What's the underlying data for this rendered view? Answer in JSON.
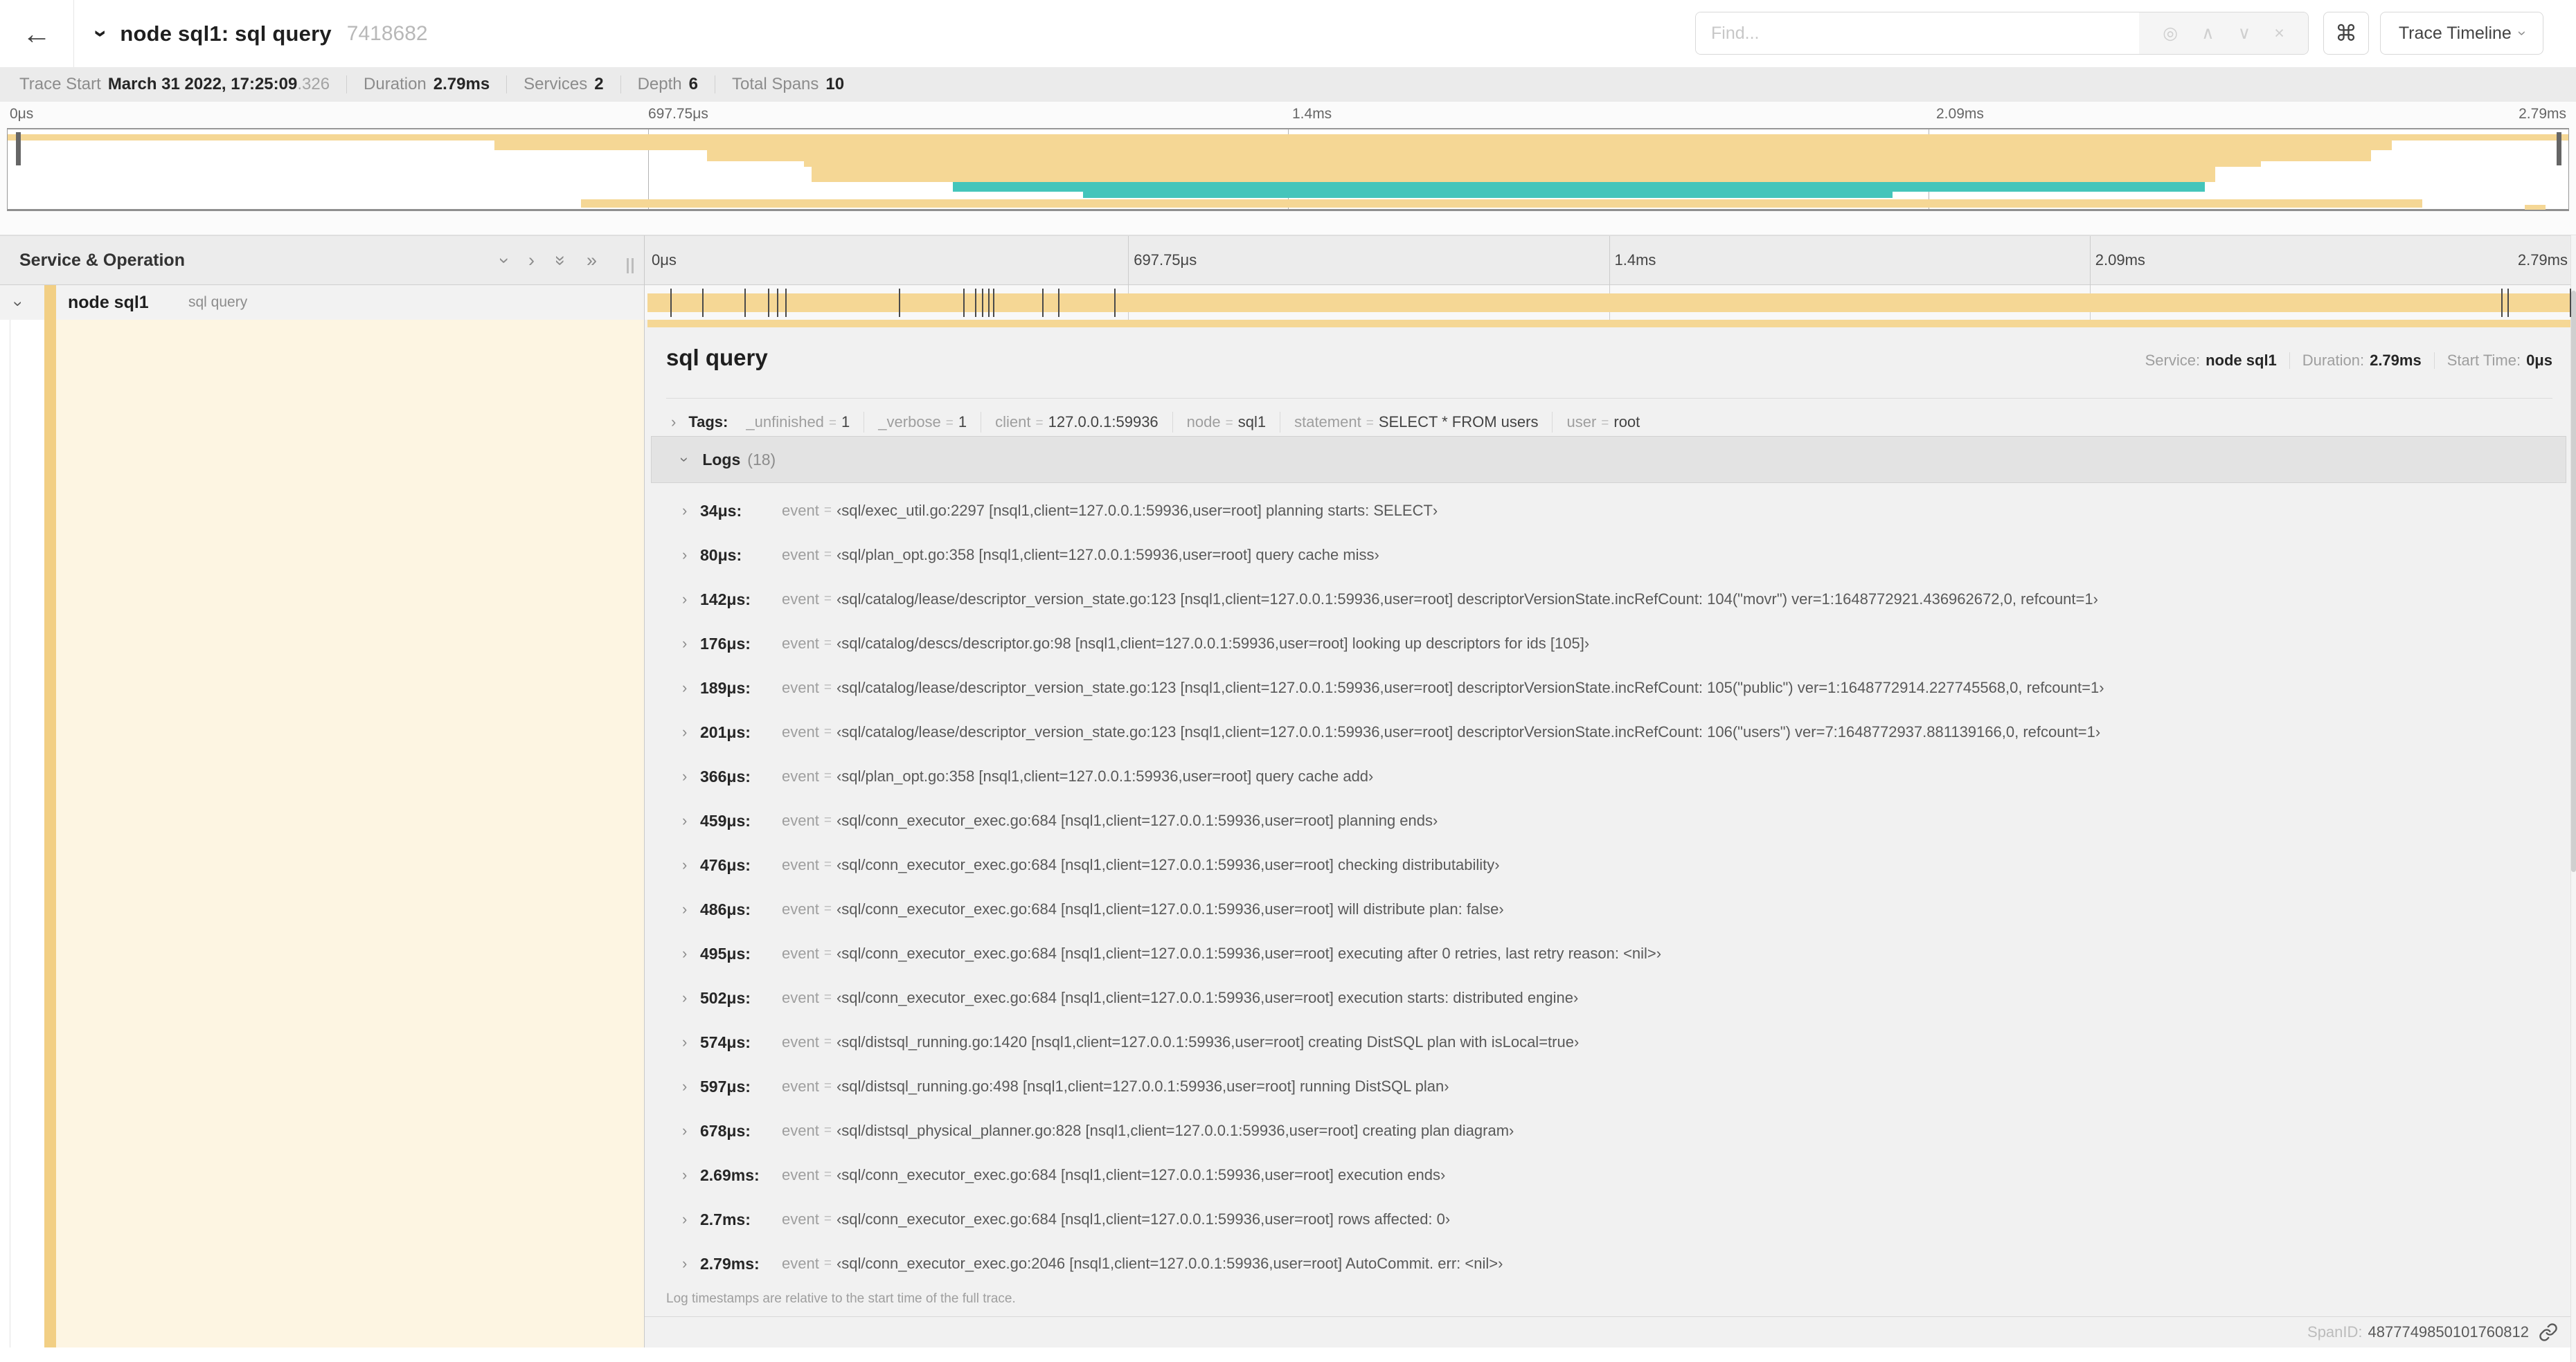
{
  "colors": {
    "span": "#f5d795",
    "span_stripe": "#f2cf84",
    "teal": "#44c5bb",
    "cream": "#fdf5e2"
  },
  "icons": {
    "back": "←",
    "chevron": "›",
    "double_chevron": "»",
    "locate": "◎",
    "prev": "∧",
    "next": "∨",
    "clear": "×",
    "command": "⌘"
  },
  "header": {
    "title": "node sql1: sql query",
    "trace_id": "7418682",
    "find_placeholder": "Find...",
    "view_dropdown": "Trace Timeline"
  },
  "trace_info": {
    "items": [
      {
        "label": "Trace Start",
        "value": "March 31 2022, 17:25:09",
        "suffix": ".326"
      },
      {
        "label": "Duration",
        "value": "2.79ms",
        "suffix": ""
      },
      {
        "label": "Services",
        "value": "2",
        "suffix": ""
      },
      {
        "label": "Depth",
        "value": "6",
        "suffix": ""
      },
      {
        "label": "Total Spans",
        "value": "10",
        "suffix": ""
      }
    ]
  },
  "ticks": [
    "0μs",
    "697.75μs",
    "1.4ms",
    "2.09ms",
    "2.79ms"
  ],
  "minimap": {
    "bars": [
      {
        "l": 0,
        "w": 100,
        "t": 7,
        "h": 9,
        "c": "span"
      },
      {
        "l": 19.0,
        "w": 74.1,
        "t": 16,
        "h": 14,
        "c": "span"
      },
      {
        "l": 27.3,
        "w": 65.0,
        "t": 30,
        "h": 16,
        "c": "span"
      },
      {
        "l": 31.1,
        "w": 56.9,
        "t": 46,
        "h": 8,
        "c": "span"
      },
      {
        "l": 31.4,
        "w": 54.8,
        "t": 54,
        "h": 22,
        "c": "span"
      },
      {
        "l": 36.9,
        "w": 48.9,
        "t": 76,
        "h": 14,
        "c": "teal"
      },
      {
        "l": 42.0,
        "w": 31.6,
        "t": 90,
        "h": 9,
        "c": "teal"
      },
      {
        "l": 22.4,
        "w": 71.9,
        "t": 101,
        "h": 12,
        "c": "span"
      },
      {
        "l": 98.3,
        "w": 0.8,
        "t": 109,
        "h": 7,
        "c": "span"
      }
    ],
    "gridlines_pct": [
      25,
      50,
      75
    ]
  },
  "timeline": {
    "column_header": "Service & Operation",
    "row": {
      "service": "node sql1",
      "operation": "sql query"
    },
    "log_tick_pct": [
      1.22,
      2.87,
      5.09,
      6.31,
      6.77,
      7.2,
      13.12,
      16.45,
      17.06,
      17.42,
      17.74,
      17.99,
      20.57,
      21.4,
      24.3,
      96.42,
      96.77,
      100
    ]
  },
  "span_detail": {
    "title": "sql query",
    "stats": [
      {
        "label": "Service:",
        "value": "node sql1"
      },
      {
        "label": "Duration:",
        "value": "2.79ms"
      },
      {
        "label": "Start Time:",
        "value": "0μs"
      }
    ],
    "tags_label": "Tags:",
    "tags": [
      {
        "key": "_unfinished",
        "value": "1"
      },
      {
        "key": "_verbose",
        "value": "1"
      },
      {
        "key": "client",
        "value": "127.0.0.1:59936"
      },
      {
        "key": "node",
        "value": "sql1"
      },
      {
        "key": "statement",
        "value": "SELECT * FROM users"
      },
      {
        "key": "user",
        "value": "root"
      }
    ],
    "logs_label": "Logs",
    "logs_count": "(18)",
    "log_field_key": "event",
    "logs": [
      {
        "time": "34μs:",
        "value": "‹sql/exec_util.go:2297 [nsql1,client=127.0.0.1:59936,user=root] planning starts: SELECT›"
      },
      {
        "time": "80μs:",
        "value": "‹sql/plan_opt.go:358 [nsql1,client=127.0.0.1:59936,user=root] query cache miss›"
      },
      {
        "time": "142μs:",
        "value": "‹sql/catalog/lease/descriptor_version_state.go:123 [nsql1,client=127.0.0.1:59936,user=root] descriptorVersionState.incRefCount: 104(\"movr\") ver=1:1648772921.436962672,0, refcount=1›"
      },
      {
        "time": "176μs:",
        "value": "‹sql/catalog/descs/descriptor.go:98 [nsql1,client=127.0.0.1:59936,user=root] looking up descriptors for ids [105]›"
      },
      {
        "time": "189μs:",
        "value": "‹sql/catalog/lease/descriptor_version_state.go:123 [nsql1,client=127.0.0.1:59936,user=root] descriptorVersionState.incRefCount: 105(\"public\") ver=1:1648772914.227745568,0, refcount=1›"
      },
      {
        "time": "201μs:",
        "value": "‹sql/catalog/lease/descriptor_version_state.go:123 [nsql1,client=127.0.0.1:59936,user=root] descriptorVersionState.incRefCount: 106(\"users\") ver=7:1648772937.881139166,0, refcount=1›"
      },
      {
        "time": "366μs:",
        "value": "‹sql/plan_opt.go:358 [nsql1,client=127.0.0.1:59936,user=root] query cache add›"
      },
      {
        "time": "459μs:",
        "value": "‹sql/conn_executor_exec.go:684 [nsql1,client=127.0.0.1:59936,user=root] planning ends›"
      },
      {
        "time": "476μs:",
        "value": "‹sql/conn_executor_exec.go:684 [nsql1,client=127.0.0.1:59936,user=root] checking distributability›"
      },
      {
        "time": "486μs:",
        "value": "‹sql/conn_executor_exec.go:684 [nsql1,client=127.0.0.1:59936,user=root] will distribute plan: false›"
      },
      {
        "time": "495μs:",
        "value": "‹sql/conn_executor_exec.go:684 [nsql1,client=127.0.0.1:59936,user=root] executing after 0 retries, last retry reason: <nil>›"
      },
      {
        "time": "502μs:",
        "value": "‹sql/conn_executor_exec.go:684 [nsql1,client=127.0.0.1:59936,user=root] execution starts: distributed engine›"
      },
      {
        "time": "574μs:",
        "value": "‹sql/distsql_running.go:1420 [nsql1,client=127.0.0.1:59936,user=root] creating DistSQL plan with isLocal=true›"
      },
      {
        "time": "597μs:",
        "value": "‹sql/distsql_running.go:498 [nsql1,client=127.0.0.1:59936,user=root] running DistSQL plan›"
      },
      {
        "time": "678μs:",
        "value": "‹sql/distsql_physical_planner.go:828 [nsql1,client=127.0.0.1:59936,user=root] creating plan diagram›"
      },
      {
        "time": "2.69ms:",
        "value": "‹sql/conn_executor_exec.go:684 [nsql1,client=127.0.0.1:59936,user=root] execution ends›"
      },
      {
        "time": "2.7ms:",
        "value": "‹sql/conn_executor_exec.go:684 [nsql1,client=127.0.0.1:59936,user=root] rows affected: 0›"
      },
      {
        "time": "2.79ms:",
        "value": "‹sql/conn_executor_exec.go:2046 [nsql1,client=127.0.0.1:59936,user=root] AutoCommit. err: <nil>›"
      }
    ],
    "footnote": "Log timestamps are relative to the start time of the full trace.",
    "spanid_label": "SpanID:",
    "spanid": "4877749850101760812"
  }
}
